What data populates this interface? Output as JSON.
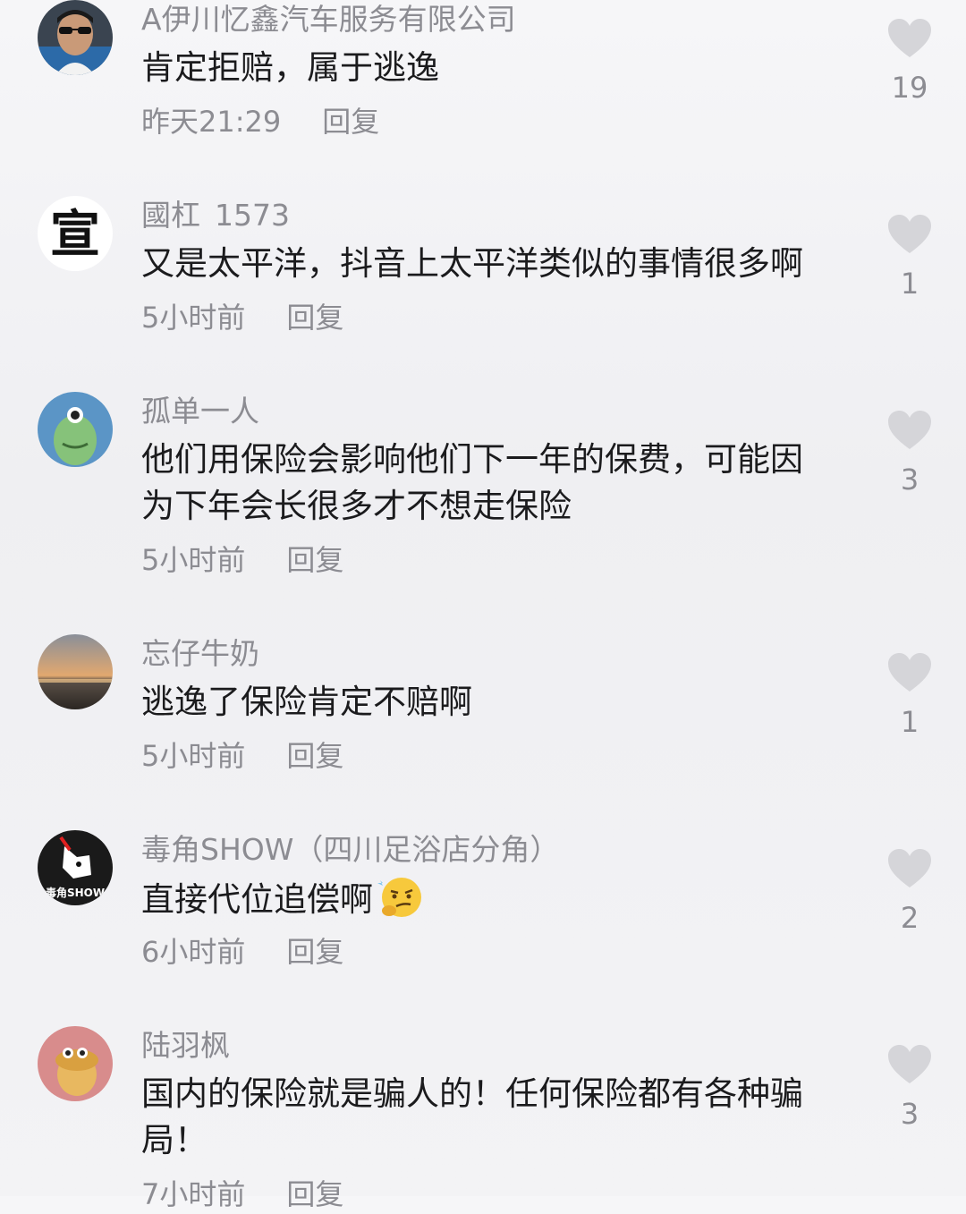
{
  "comments": [
    {
      "user": "A伊川忆鑫汽车服务有限公司",
      "badge": "",
      "text_lines": [
        "肯定拒赔，属于逃逸"
      ],
      "time": "昨天21:29",
      "reply": "回复",
      "likes": "19"
    },
    {
      "user": "國杠",
      "badge": "1573",
      "text_lines": [
        "又是太平洋，抖音上太平洋类似的事情很多啊"
      ],
      "time": "5小时前",
      "reply": "回复",
      "likes": "1",
      "avatar_char": "宣"
    },
    {
      "user": "孤单一人",
      "badge": "",
      "text_lines": [
        "他们用保险会影响他们下一年的保费，可能因",
        "为下年会长很多才不想走保险"
      ],
      "time": "5小时前",
      "reply": "回复",
      "likes": "3"
    },
    {
      "user": "忘仔牛奶",
      "badge": "",
      "text_lines": [
        "逃逸了保险肯定不赔啊"
      ],
      "time": "5小时前",
      "reply": "回复",
      "likes": "1"
    },
    {
      "user": "毒角SHOW（四川足浴店分角）",
      "badge": "",
      "text_lines": [
        "直接代位追偿啊"
      ],
      "time": "6小时前",
      "reply": "回复",
      "likes": "2",
      "avatar_text": "毒角SHOW"
    },
    {
      "user": "陆羽枫",
      "badge": "",
      "text_lines": [
        "国内的保险就是骗人的！任何保险都有各种骗",
        "局！"
      ],
      "time": "7小时前",
      "reply": "回复",
      "likes": "3"
    }
  ],
  "icons": {
    "like": "heart-icon",
    "emoji": "thinking-smirk-emoji"
  },
  "colors": {
    "heart": "#d5d5d9",
    "text": "#1b1b1d",
    "secondary": "#8c8c92"
  }
}
